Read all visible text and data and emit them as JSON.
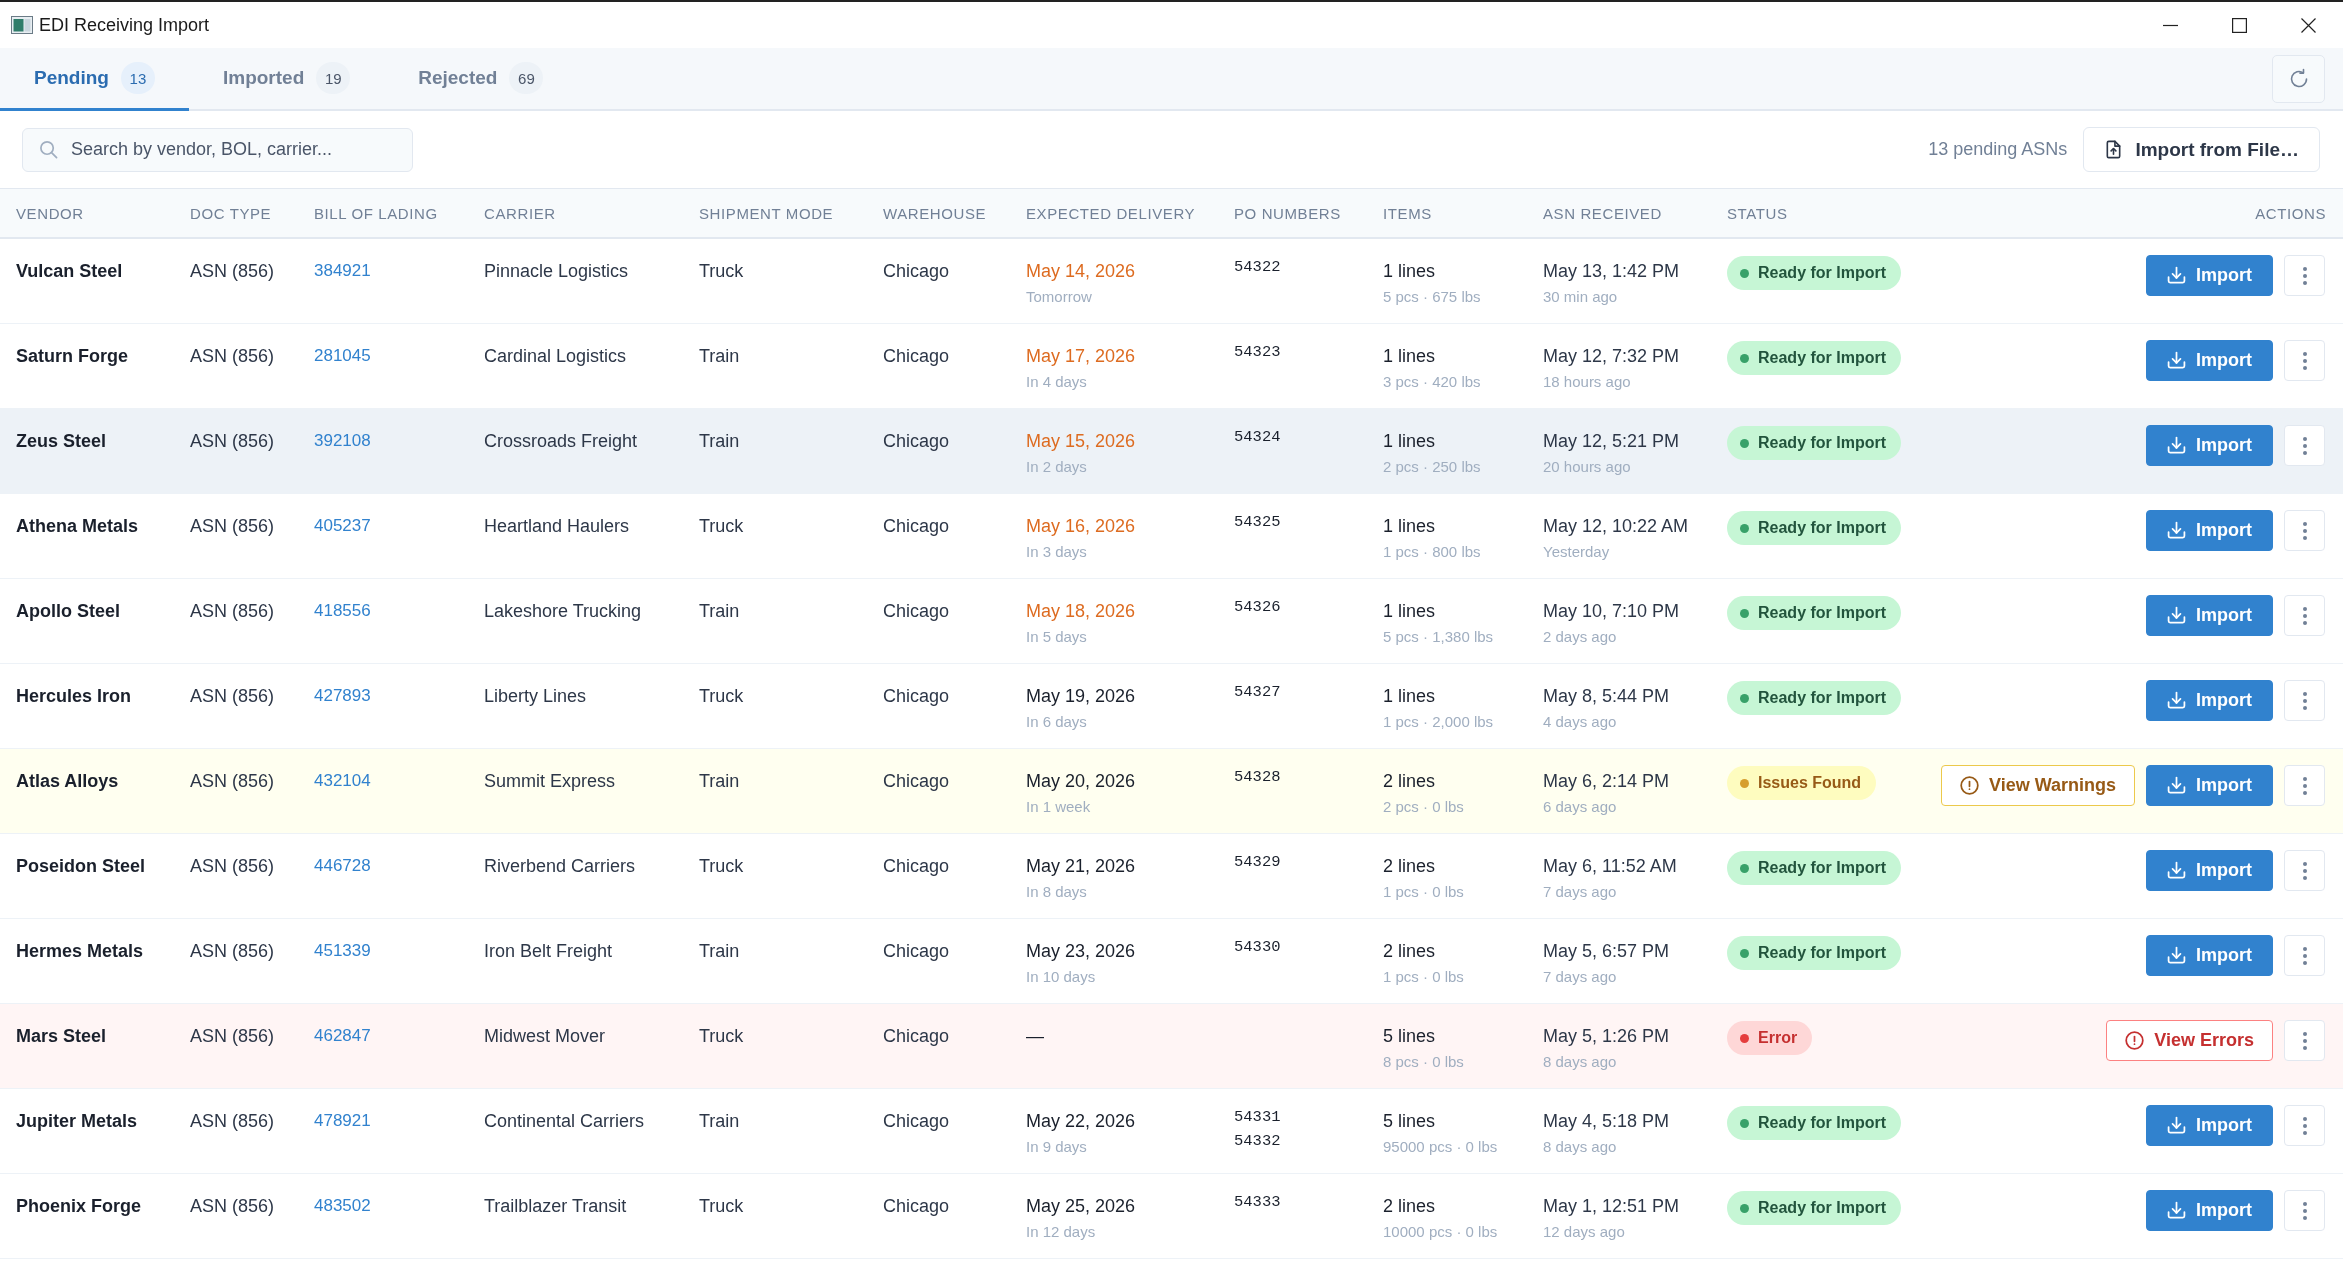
{
  "window": {
    "title": "EDI Receiving Import"
  },
  "tabs": [
    {
      "label": "Pending",
      "count": "13",
      "selected": true
    },
    {
      "label": "Imported",
      "count": "19",
      "selected": false
    },
    {
      "label": "Rejected",
      "count": "69",
      "selected": false
    }
  ],
  "toolbar": {
    "search": {
      "placeholder": "Search by vendor, BOL, carrier..."
    },
    "summary": "13 pending ASNs",
    "import_button": "Import from File…"
  },
  "table": {
    "columns": [
      "VENDOR",
      "DOC TYPE",
      "BILL OF LADING",
      "CARRIER",
      "SHIPMENT MODE",
      "WAREHOUSE",
      "EXPECTED DELIVERY",
      "PO NUMBERS",
      "ITEMS",
      "ASN RECEIVED",
      "STATUS",
      "ACTIONS"
    ],
    "rows": [
      {
        "vendor": "Vulcan Steel",
        "doc_type": "ASN (856)",
        "bill_of_lading": "384921",
        "carrier": "Pinnacle Logistics",
        "shipment_mode": "Truck",
        "warehouse": "Chicago",
        "expected_delivery": {
          "date": "May 14, 2026",
          "relative": "Tomorrow",
          "soon": true
        },
        "po_numbers": [
          "54322"
        ],
        "items": {
          "lines": "1 lines",
          "detail": "5 pcs · 675 lbs"
        },
        "asn_received": {
          "time": "May 13, 1:42 PM",
          "relative": "30 min ago"
        },
        "status": {
          "kind": "ready",
          "label": "Ready for Import"
        },
        "actions": [
          {
            "kind": "import",
            "label": "Import"
          }
        ],
        "hovered": false
      },
      {
        "vendor": "Saturn Forge",
        "doc_type": "ASN (856)",
        "bill_of_lading": "281045",
        "carrier": "Cardinal Logistics",
        "shipment_mode": "Train",
        "warehouse": "Chicago",
        "expected_delivery": {
          "date": "May 17, 2026",
          "relative": "In 4 days",
          "soon": true
        },
        "po_numbers": [
          "54323"
        ],
        "items": {
          "lines": "1 lines",
          "detail": "3 pcs · 420 lbs"
        },
        "asn_received": {
          "time": "May 12, 7:32 PM",
          "relative": "18 hours ago"
        },
        "status": {
          "kind": "ready",
          "label": "Ready for Import"
        },
        "actions": [
          {
            "kind": "import",
            "label": "Import"
          }
        ],
        "hovered": false
      },
      {
        "vendor": "Zeus Steel",
        "doc_type": "ASN (856)",
        "bill_of_lading": "392108",
        "carrier": "Crossroads Freight",
        "shipment_mode": "Train",
        "warehouse": "Chicago",
        "expected_delivery": {
          "date": "May 15, 2026",
          "relative": "In 2 days",
          "soon": true
        },
        "po_numbers": [
          "54324"
        ],
        "items": {
          "lines": "1 lines",
          "detail": "2 pcs · 250 lbs"
        },
        "asn_received": {
          "time": "May 12, 5:21 PM",
          "relative": "20 hours ago"
        },
        "status": {
          "kind": "ready",
          "label": "Ready for Import"
        },
        "actions": [
          {
            "kind": "import",
            "label": "Import"
          }
        ],
        "hovered": true
      },
      {
        "vendor": "Athena Metals",
        "doc_type": "ASN (856)",
        "bill_of_lading": "405237",
        "carrier": "Heartland Haulers",
        "shipment_mode": "Truck",
        "warehouse": "Chicago",
        "expected_delivery": {
          "date": "May 16, 2026",
          "relative": "In 3 days",
          "soon": true
        },
        "po_numbers": [
          "54325"
        ],
        "items": {
          "lines": "1 lines",
          "detail": "1 pcs · 800 lbs"
        },
        "asn_received": {
          "time": "May 12, 10:22 AM",
          "relative": "Yesterday"
        },
        "status": {
          "kind": "ready",
          "label": "Ready for Import"
        },
        "actions": [
          {
            "kind": "import",
            "label": "Import"
          }
        ],
        "hovered": false
      },
      {
        "vendor": "Apollo Steel",
        "doc_type": "ASN (856)",
        "bill_of_lading": "418556",
        "carrier": "Lakeshore Trucking",
        "shipment_mode": "Train",
        "warehouse": "Chicago",
        "expected_delivery": {
          "date": "May 18, 2026",
          "relative": "In 5 days",
          "soon": true
        },
        "po_numbers": [
          "54326"
        ],
        "items": {
          "lines": "1 lines",
          "detail": "5 pcs · 1,380 lbs"
        },
        "asn_received": {
          "time": "May 10, 7:10 PM",
          "relative": "2 days ago"
        },
        "status": {
          "kind": "ready",
          "label": "Ready for Import"
        },
        "actions": [
          {
            "kind": "import",
            "label": "Import"
          }
        ],
        "hovered": false
      },
      {
        "vendor": "Hercules Iron",
        "doc_type": "ASN (856)",
        "bill_of_lading": "427893",
        "carrier": "Liberty Lines",
        "shipment_mode": "Truck",
        "warehouse": "Chicago",
        "expected_delivery": {
          "date": "May 19, 2026",
          "relative": "In 6 days",
          "soon": false
        },
        "po_numbers": [
          "54327"
        ],
        "items": {
          "lines": "1 lines",
          "detail": "1 pcs · 2,000 lbs"
        },
        "asn_received": {
          "time": "May 8, 5:44 PM",
          "relative": "4 days ago"
        },
        "status": {
          "kind": "ready",
          "label": "Ready for Import"
        },
        "actions": [
          {
            "kind": "import",
            "label": "Import"
          }
        ],
        "hovered": false
      },
      {
        "vendor": "Atlas Alloys",
        "doc_type": "ASN (856)",
        "bill_of_lading": "432104",
        "carrier": "Summit Express",
        "shipment_mode": "Train",
        "warehouse": "Chicago",
        "expected_delivery": {
          "date": "May 20, 2026",
          "relative": "In 1 week",
          "soon": false
        },
        "po_numbers": [
          "54328"
        ],
        "items": {
          "lines": "2 lines",
          "detail": "2 pcs · 0 lbs"
        },
        "asn_received": {
          "time": "May 6, 2:14 PM",
          "relative": "6 days ago"
        },
        "status": {
          "kind": "warning",
          "label": "Issues Found"
        },
        "actions": [
          {
            "kind": "warnings",
            "label": "View Warnings"
          },
          {
            "kind": "import",
            "label": "Import"
          }
        ],
        "hovered": false
      },
      {
        "vendor": "Poseidon Steel",
        "doc_type": "ASN (856)",
        "bill_of_lading": "446728",
        "carrier": "Riverbend Carriers",
        "shipment_mode": "Truck",
        "warehouse": "Chicago",
        "expected_delivery": {
          "date": "May 21, 2026",
          "relative": "In 8 days",
          "soon": false
        },
        "po_numbers": [
          "54329"
        ],
        "items": {
          "lines": "2 lines",
          "detail": "1 pcs · 0 lbs"
        },
        "asn_received": {
          "time": "May 6, 11:52 AM",
          "relative": "7 days ago"
        },
        "status": {
          "kind": "ready",
          "label": "Ready for Import"
        },
        "actions": [
          {
            "kind": "import",
            "label": "Import"
          }
        ],
        "hovered": false
      },
      {
        "vendor": "Hermes Metals",
        "doc_type": "ASN (856)",
        "bill_of_lading": "451339",
        "carrier": "Iron Belt Freight",
        "shipment_mode": "Train",
        "warehouse": "Chicago",
        "expected_delivery": {
          "date": "May 23, 2026",
          "relative": "In 10 days",
          "soon": false
        },
        "po_numbers": [
          "54330"
        ],
        "items": {
          "lines": "2 lines",
          "detail": "1 pcs · 0 lbs"
        },
        "asn_received": {
          "time": "May 5, 6:57 PM",
          "relative": "7 days ago"
        },
        "status": {
          "kind": "ready",
          "label": "Ready for Import"
        },
        "actions": [
          {
            "kind": "import",
            "label": "Import"
          }
        ],
        "hovered": false
      },
      {
        "vendor": "Mars Steel",
        "doc_type": "ASN (856)",
        "bill_of_lading": "462847",
        "carrier": "Midwest Mover",
        "shipment_mode": "Truck",
        "warehouse": "Chicago",
        "expected_delivery": {
          "date": "—",
          "soon": false
        },
        "items": {
          "lines": "5 lines",
          "detail": "8 pcs · 0 lbs"
        },
        "asn_received": {
          "time": "May 5, 1:26 PM",
          "relative": "8 days ago"
        },
        "status": {
          "kind": "error",
          "label": "Error"
        },
        "actions": [
          {
            "kind": "errors",
            "label": "View Errors"
          }
        ],
        "hovered": false
      },
      {
        "vendor": "Jupiter Metals",
        "doc_type": "ASN (856)",
        "bill_of_lading": "478921",
        "carrier": "Continental Carriers",
        "shipment_mode": "Train",
        "warehouse": "Chicago",
        "expected_delivery": {
          "date": "May 22, 2026",
          "relative": "In 9 days",
          "soon": false
        },
        "po_numbers": [
          "54331",
          "54332"
        ],
        "items": {
          "lines": "5 lines",
          "detail": "95000 pcs · 0 lbs"
        },
        "asn_received": {
          "time": "May 4, 5:18 PM",
          "relative": "8 days ago"
        },
        "status": {
          "kind": "ready",
          "label": "Ready for Import"
        },
        "actions": [
          {
            "kind": "import",
            "label": "Import"
          }
        ],
        "hovered": false
      },
      {
        "vendor": "Phoenix Forge",
        "doc_type": "ASN (856)",
        "bill_of_lading": "483502",
        "carrier": "Trailblazer Transit",
        "shipment_mode": "Truck",
        "warehouse": "Chicago",
        "expected_delivery": {
          "date": "May 25, 2026",
          "relative": "In 12 days",
          "soon": false
        },
        "po_numbers": [
          "54333"
        ],
        "items": {
          "lines": "2 lines",
          "detail": "10000 pcs · 0 lbs"
        },
        "asn_received": {
          "time": "May 1, 12:51 PM",
          "relative": "12 days ago"
        },
        "status": {
          "kind": "ready",
          "label": "Ready for Import"
        },
        "actions": [
          {
            "kind": "import",
            "label": "Import"
          }
        ],
        "hovered": false
      }
    ]
  }
}
